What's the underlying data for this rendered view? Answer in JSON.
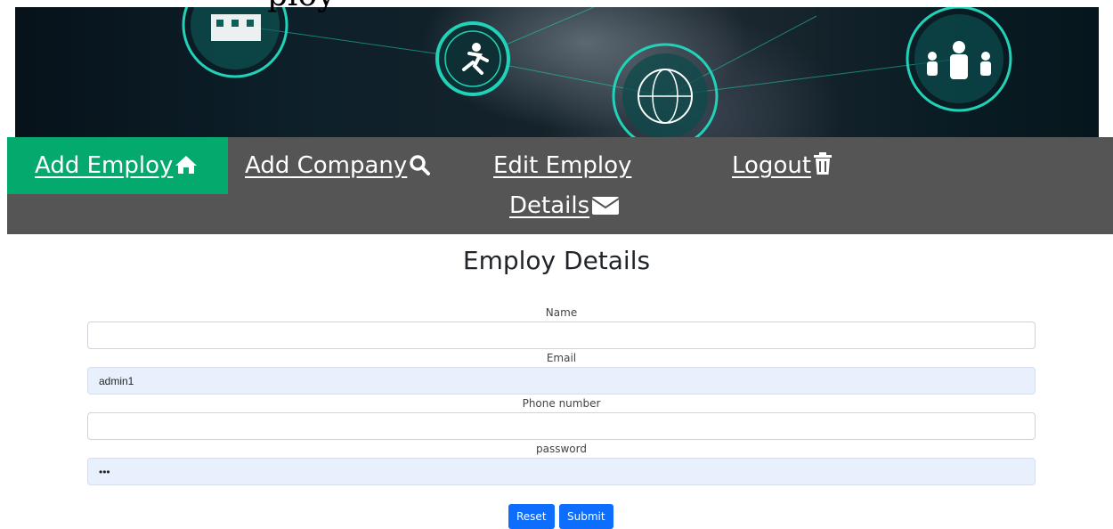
{
  "banner": {
    "title_fragment": "ploy"
  },
  "nav": {
    "items": [
      {
        "label": "Add Employ",
        "icon": "home-icon",
        "active": true
      },
      {
        "label": "Add Company",
        "icon": "search-icon",
        "active": false
      },
      {
        "label_line1": "Edit Employ",
        "label_line2": "Details",
        "icon": "envelope-icon",
        "active": false
      },
      {
        "label": "Logout",
        "icon": "trash-icon",
        "active": false
      }
    ],
    "colors": {
      "background": "#555555",
      "active": "#04aa6d",
      "text": "#ffffff"
    }
  },
  "form": {
    "title": "Employ Details",
    "fields": [
      {
        "label": "Name",
        "value": "",
        "type": "text"
      },
      {
        "label": "Email",
        "value": "admin1",
        "type": "text"
      },
      {
        "label": "Phone number",
        "value": "",
        "type": "text"
      },
      {
        "label": "password",
        "value": "•••",
        "type": "password"
      }
    ],
    "buttons": {
      "reset": "Reset",
      "submit": "Submit"
    },
    "colors": {
      "button": "#0d6efd",
      "autofill": "#e8f0fe"
    }
  }
}
